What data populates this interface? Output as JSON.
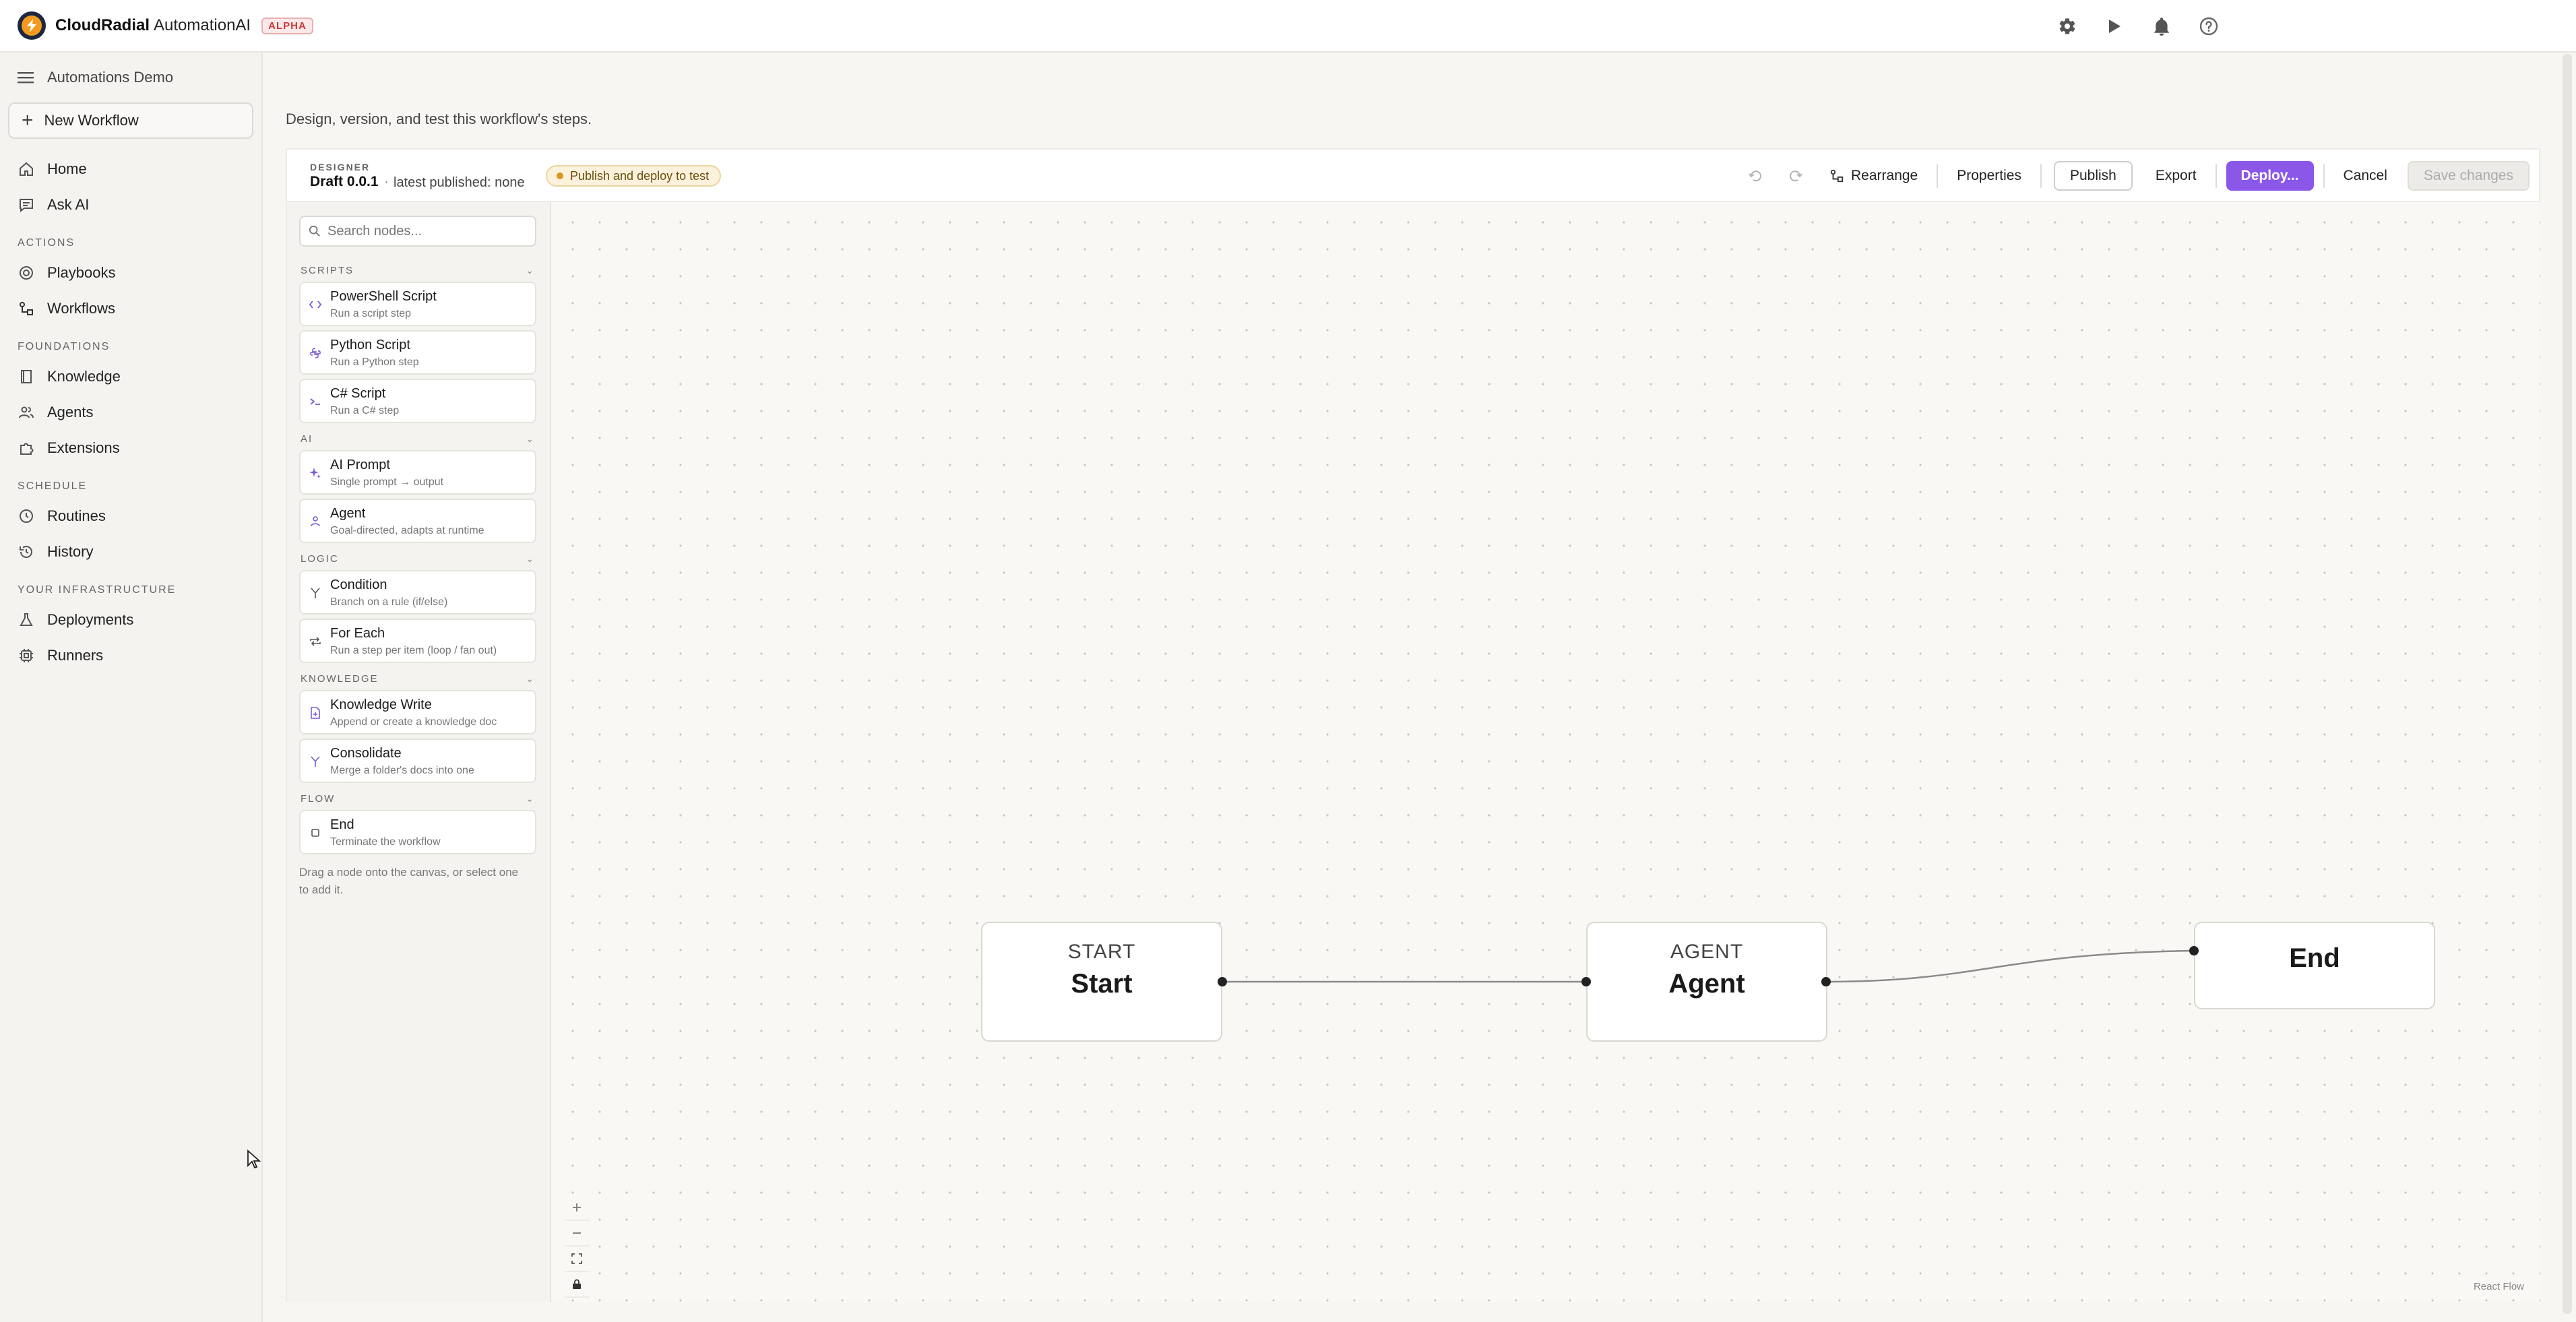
{
  "topbar": {
    "brand_name": "CloudRadial",
    "product": "AutomationAI",
    "badge": "ALPHA",
    "actions": [
      {
        "icon": "gear-icon"
      },
      {
        "icon": "play-icon"
      },
      {
        "icon": "bell-icon"
      },
      {
        "icon": "help-icon"
      }
    ]
  },
  "sidebar": {
    "workspace": "Automations Demo",
    "new_workflow": "New Workflow",
    "home": "Home",
    "ask_ai": "Ask AI",
    "sections": {
      "actions": "ACTIONS",
      "foundations": "FOUNDATIONS",
      "schedule": "SCHEDULE",
      "infrastructure": "YOUR INFRASTRUCTURE"
    },
    "items": {
      "playbooks": "Playbooks",
      "workflows": "Workflows",
      "knowledge": "Knowledge",
      "agents": "Agents",
      "extensions": "Extensions",
      "routines": "Routines",
      "history": "History",
      "deployments": "Deployments",
      "runners": "Runners"
    }
  },
  "main": {
    "subtitle": "Design, version, and test this workflow's steps."
  },
  "designer": {
    "kicker": "DESIGNER",
    "draft": "Draft 0.0.1",
    "separator": "·",
    "latest": "latest published: none",
    "status_pill": "Publish and deploy to test",
    "toolbar": {
      "rearrange": "Rearrange",
      "properties": "Properties",
      "publish": "Publish",
      "export": "Export",
      "deploy": "Deploy...",
      "cancel": "Cancel",
      "save": "Save changes"
    }
  },
  "palette": {
    "search_placeholder": "Search nodes...",
    "categories": {
      "scripts": "SCRIPTS",
      "ai": "AI",
      "logic": "LOGIC",
      "knowledge": "KNOWLEDGE",
      "flow": "FLOW"
    },
    "nodes": {
      "powershell": {
        "name": "PowerShell Script",
        "desc": "Run a script step"
      },
      "python": {
        "name": "Python Script",
        "desc": "Run a Python step"
      },
      "csharp": {
        "name": "C# Script",
        "desc": "Run a C# step"
      },
      "ai_prompt": {
        "name": "AI Prompt",
        "desc": "Single prompt → output"
      },
      "agent": {
        "name": "Agent",
        "desc": "Goal-directed, adapts at runtime"
      },
      "condition": {
        "name": "Condition",
        "desc": "Branch on a rule (if/else)"
      },
      "for_each": {
        "name": "For Each",
        "desc": "Run a step per item (loop / fan out)"
      },
      "knowledge_write": {
        "name": "Knowledge Write",
        "desc": "Append or create a knowledge doc"
      },
      "consolidate": {
        "name": "Consolidate",
        "desc": "Merge a folder's docs into one"
      },
      "end": {
        "name": "End",
        "desc": "Terminate the workflow"
      }
    },
    "hint": "Drag a node onto the canvas, or select one to add it."
  },
  "canvas": {
    "nodes": {
      "start": {
        "kind": "START",
        "title": "Start"
      },
      "agent": {
        "kind": "AGENT",
        "title": "Agent"
      },
      "end": {
        "title": "End"
      }
    },
    "watermark": "React Flow"
  },
  "colors": {
    "accent": "#8a57e8",
    "pill_bg": "#fbf1dc",
    "badge": "#c73b3b",
    "palette_icon": "#7b5bd6"
  }
}
